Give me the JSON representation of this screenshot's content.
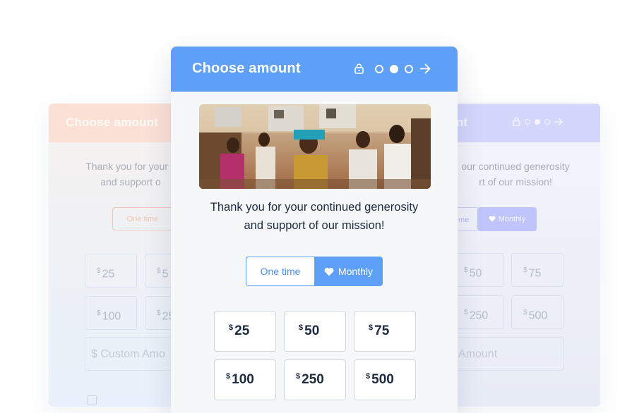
{
  "left_card": {
    "title": "Choose amount",
    "message_line1": "Thank you for your c",
    "message_line2": "and support o",
    "toggle_label": "One time",
    "amounts": [
      "25",
      "5",
      "100",
      "25"
    ],
    "currency": "$",
    "custom_placeholder": "Custom Amo"
  },
  "right_card": {
    "title_fragment": "nt",
    "message_line1": "our continued generosity",
    "message_line2": "rt of our mission!",
    "toggle_one_fragment": "me",
    "toggle_monthly": "Monthly",
    "amounts": [
      "50",
      "75",
      "250",
      "500"
    ],
    "currency": "$",
    "custom_placeholder": "Amount"
  },
  "main_card": {
    "title": "Choose amount",
    "steps": {
      "total": 3,
      "current": 2
    },
    "message_line1": "Thank you for your continued generosity",
    "message_line2": "and support of our mission!",
    "frequency": {
      "one_time_label": "One time",
      "monthly_label": "Monthly",
      "selected": "Monthly"
    },
    "currency": "$",
    "amounts": [
      "25",
      "50",
      "75",
      "100",
      "250",
      "500"
    ]
  },
  "colors": {
    "primary": "#5ea0f7",
    "text_dark": "#1c2b3f",
    "left_header": "#fbe0d6",
    "right_header": "#d4d6fb"
  },
  "icons": [
    "lock-icon",
    "step-dot-icon",
    "arrow-right-icon",
    "heart-icon"
  ]
}
